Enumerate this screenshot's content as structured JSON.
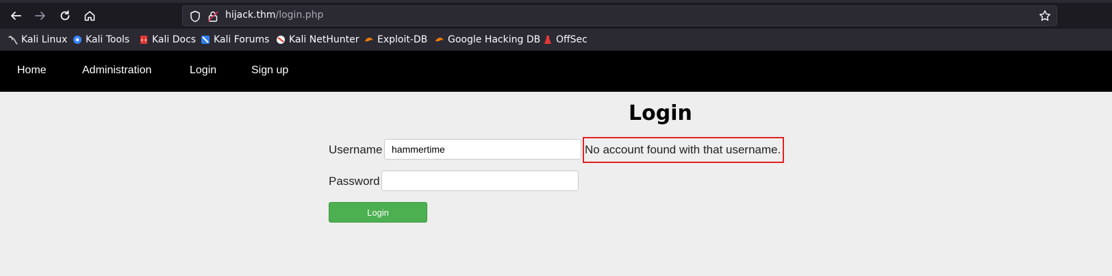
{
  "browser": {
    "url_host": "hijack.thm",
    "url_path": "/login.php"
  },
  "bookmarks": [
    {
      "label": "Kali Linux",
      "icon": "kali-dragon-icon",
      "color": "#cccccc"
    },
    {
      "label": "Kali Tools",
      "icon": "kali-tools-icon",
      "color": "#3a86ff"
    },
    {
      "label": "Kali Docs",
      "icon": "kali-docs-icon",
      "color": "#e53935"
    },
    {
      "label": "Kali Forums",
      "icon": "kali-forums-icon",
      "color": "#2f80ed"
    },
    {
      "label": "Kali NetHunter",
      "icon": "kali-nethunter-icon",
      "color": "#e53935"
    },
    {
      "label": "Exploit-DB",
      "icon": "exploit-db-icon",
      "color": "#f57c00"
    },
    {
      "label": "Google Hacking DB",
      "icon": "ghdb-icon",
      "color": "#f57c00"
    },
    {
      "label": "OffSec",
      "icon": "offsec-icon",
      "color": "#e53935"
    }
  ],
  "nav": {
    "items": [
      "Home",
      "Administration",
      "Login",
      "Sign up"
    ]
  },
  "form": {
    "title": "Login",
    "username_label": "Username",
    "username_value": "hammertime",
    "password_label": "Password",
    "password_value": "",
    "error": "No account found with that username.",
    "submit_label": "Login"
  },
  "colors": {
    "accent_button": "#4caf50",
    "error_border": "#e02020",
    "navbar": "#000000"
  }
}
